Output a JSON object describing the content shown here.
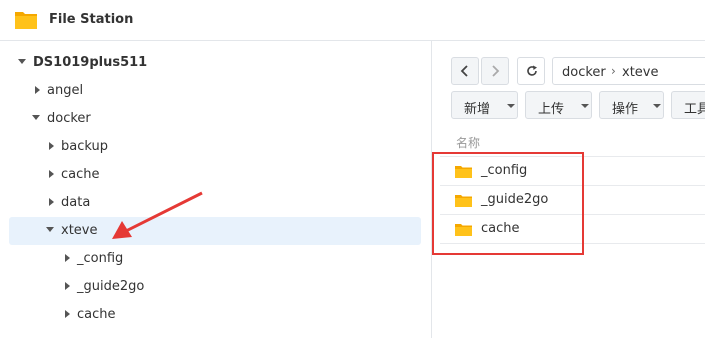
{
  "app": {
    "title": "File Station",
    "icon": "folder-icon",
    "accent": "#f5b400"
  },
  "tree": {
    "root": "DS1019plus511",
    "items": [
      {
        "label": "angel",
        "expanded": false
      },
      {
        "label": "docker",
        "expanded": true
      },
      {
        "label": "backup",
        "expanded": false
      },
      {
        "label": "cache",
        "expanded": false
      },
      {
        "label": "data",
        "expanded": false
      },
      {
        "label": "xteve",
        "expanded": true,
        "selected": true
      },
      {
        "label": "_config",
        "expanded": false
      },
      {
        "label": "_guide2go",
        "expanded": false
      },
      {
        "label": "cache",
        "expanded": false
      }
    ]
  },
  "path": {
    "segments": [
      "docker",
      "xteve"
    ],
    "separator": "›"
  },
  "toolbar": {
    "create": "新增",
    "upload": "上传",
    "action": "操作",
    "tools": "工具"
  },
  "list": {
    "name_header": "名称",
    "files": [
      "_config",
      "_guide2go",
      "cache"
    ]
  },
  "colors": {
    "annotation": "#e53935",
    "selected_bg": "#e8f2fc",
    "folder": "#f5b400"
  }
}
